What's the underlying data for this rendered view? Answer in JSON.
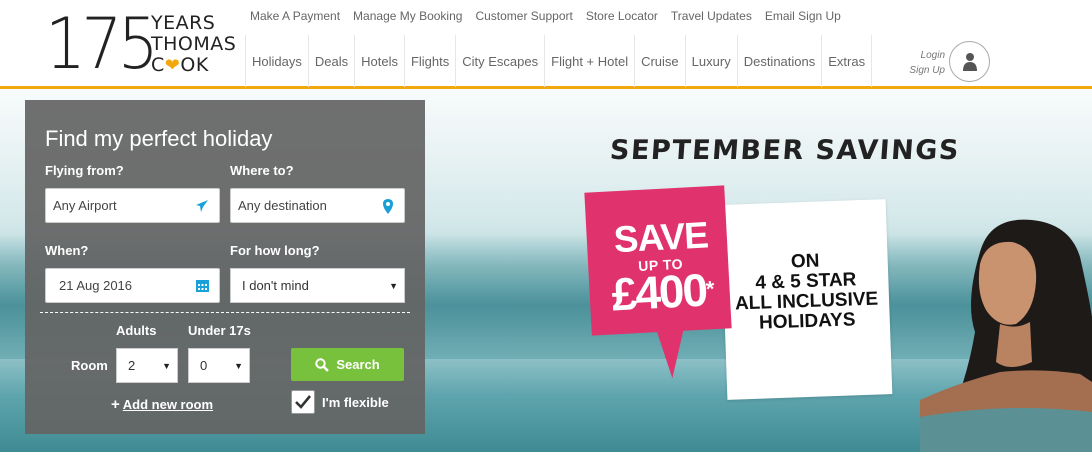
{
  "logo": {
    "number": "175",
    "line1": "YEARS",
    "line2": "THOMAS",
    "line3a": "C",
    "line3b": "OK",
    "heart_icon": "heart-icon",
    "brand_color": "#f2a70d"
  },
  "top_links": [
    "Make A Payment",
    "Manage My Booking",
    "Customer Support",
    "Store Locator",
    "Travel Updates",
    "Email Sign Up"
  ],
  "main_nav": [
    "Holidays",
    "Deals",
    "Hotels",
    "Flights",
    "City Escapes",
    "Flight + Hotel",
    "Cruise",
    "Luxury",
    "Destinations",
    "Extras"
  ],
  "account": {
    "login": "Login",
    "signup": "Sign Up",
    "avatar_icon": "user-icon"
  },
  "search_panel": {
    "title": "Find my perfect holiday",
    "flying_from_label": "Flying from?",
    "flying_from_value": "Any Airport",
    "flying_from_icon": "plane-icon",
    "where_to_label": "Where to?",
    "where_to_value": "Any destination",
    "where_to_icon": "map-pin-icon",
    "when_label": "When?",
    "when_value": "21 Aug 2016",
    "when_icon": "calendar-icon",
    "duration_label": "For how long?",
    "duration_value": "I don't mind",
    "adults_label": "Adults",
    "under17_label": "Under 17s",
    "room_label": "Room",
    "adults_value": "2",
    "under17_value": "0",
    "search_label": "Search",
    "search_icon": "search-icon",
    "add_room_plus": "+",
    "add_room_label": "Add new room",
    "flexible_label": "I'm flexible",
    "flexible_checked": true,
    "accent_color": "#78c13c"
  },
  "promo": {
    "headline": "SEPTEMBER SAVINGS",
    "save": "SAVE",
    "upto": "UP TO",
    "amount": "£400",
    "asterisk": "*",
    "on": "ON",
    "line1": "4 & 5 STAR",
    "line2": "ALL INCLUSIVE",
    "line3": "HOLIDAYS",
    "pink_color": "#e0336d"
  }
}
